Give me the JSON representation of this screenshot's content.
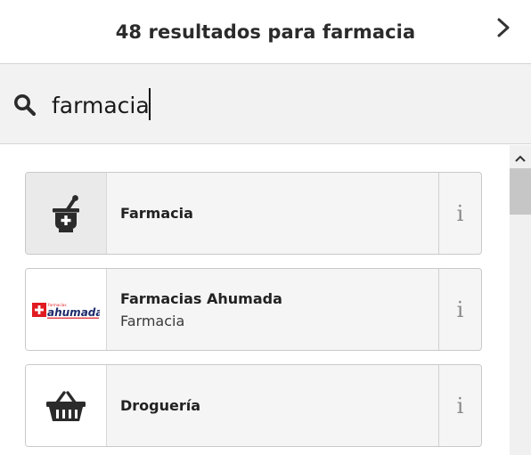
{
  "header": {
    "title": "48 resultados para farmacia",
    "next_icon": "chevron-right-icon"
  },
  "search": {
    "value": "farmacia",
    "icon": "search-icon"
  },
  "results": [
    {
      "name": "Farmacia",
      "subtitle": "",
      "icon": "mortar-pestle-icon",
      "info_label": "i"
    },
    {
      "name": "Farmacias Ahumada",
      "subtitle": "Farmacia",
      "logo_text": "farmacias ahumada",
      "info_label": "i"
    },
    {
      "name": "Droguería",
      "subtitle": "",
      "icon": "basket-icon",
      "info_label": "i"
    }
  ],
  "colors": {
    "accent_red": "#e11b22",
    "brand_navy": "#1d2a6b",
    "icon_dark": "#2b2b2b"
  }
}
